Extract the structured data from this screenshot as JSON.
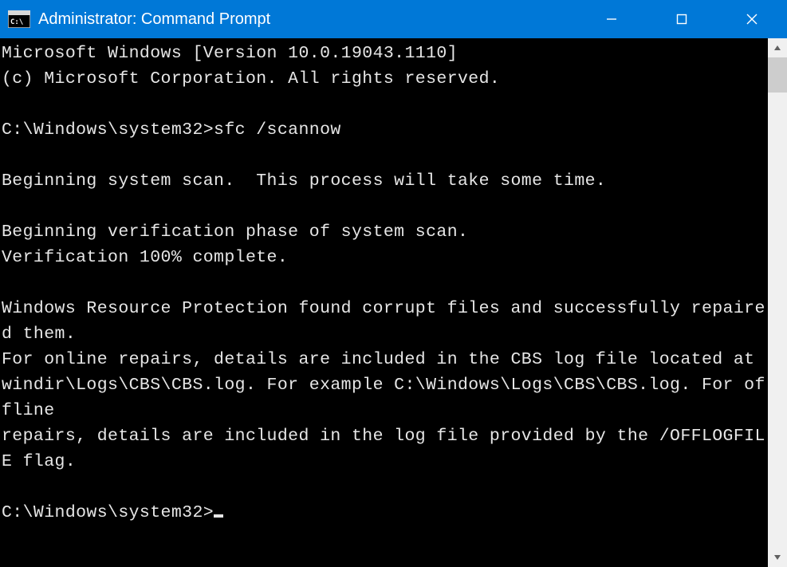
{
  "window": {
    "title": "Administrator: Command Prompt"
  },
  "terminal": {
    "lines": [
      "Microsoft Windows [Version 10.0.19043.1110]",
      "(c) Microsoft Corporation. All rights reserved.",
      "",
      "C:\\Windows\\system32>sfc /scannow",
      "",
      "Beginning system scan.  This process will take some time.",
      "",
      "Beginning verification phase of system scan.",
      "Verification 100% complete.",
      "",
      "Windows Resource Protection found corrupt files and successfully repaired them.",
      "For online repairs, details are included in the CBS log file located at",
      "windir\\Logs\\CBS\\CBS.log. For example C:\\Windows\\Logs\\CBS\\CBS.log. For offline",
      "repairs, details are included in the log file provided by the /OFFLOGFILE flag.",
      "",
      "C:\\Windows\\system32>"
    ],
    "prompt_path": "C:\\Windows\\system32>",
    "command": "sfc /scannow",
    "version_line": "Microsoft Windows [Version 10.0.19043.1110]",
    "copyright_line": "(c) Microsoft Corporation. All rights reserved."
  }
}
